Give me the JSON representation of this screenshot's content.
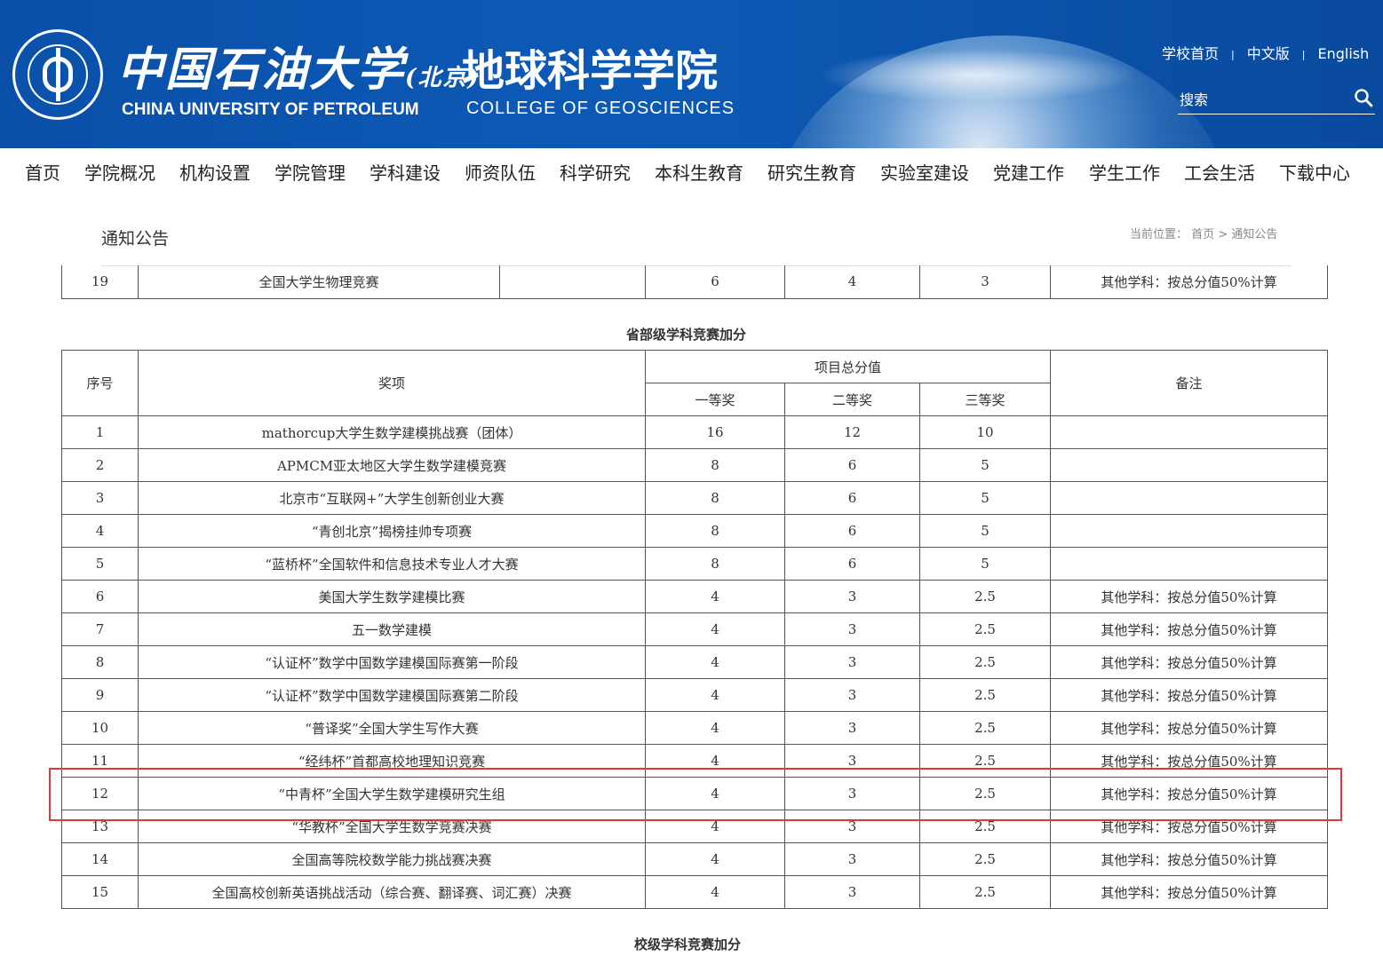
{
  "header": {
    "university_cn": "中国石油大学",
    "university_cn_suffix": "(北京)",
    "university_en": "CHINA UNIVERSITY OF PETROLEUM",
    "college_cn": "地球科学学院",
    "college_en": "COLLEGE OF GEOSCIENCES",
    "top_links": [
      "学校首页",
      "中文版",
      "English"
    ],
    "top_link_separator": "|",
    "search_placeholder": "搜索",
    "colors": {
      "header_bg": "#0c5ab6",
      "highlight": "#e5343a"
    }
  },
  "nav": {
    "items": [
      "首页",
      "学院概况",
      "机构设置",
      "学院管理",
      "学科建设",
      "师资队伍",
      "科学研究",
      "本科生教育",
      "研究生教育",
      "实验室建设",
      "党建工作",
      "学生工作",
      "工会生活",
      "下载中心"
    ]
  },
  "page": {
    "section_title": "通知公告",
    "breadcrumb_prefix": "当前位置：",
    "breadcrumb_home": "首页",
    "breadcrumb_sep": ">",
    "breadcrumb_current": "通知公告"
  },
  "prev_table": {
    "row": {
      "no": "19",
      "name": "全国大学生物理竞赛",
      "first": "6",
      "second": "4",
      "third": "3",
      "note": "其他学科：按总分值50%计算"
    }
  },
  "provincial_table": {
    "caption": "省部级学科竞赛加分",
    "headers": {
      "no": "序号",
      "name": "奖项",
      "total": "项目总分值",
      "first": "一等奖",
      "second": "二等奖",
      "third": "三等奖",
      "note": "备注"
    },
    "rows": [
      {
        "no": "1",
        "name": "mathorcup大学生数学建模挑战赛（团体）",
        "first": "16",
        "second": "12",
        "third": "10",
        "note": ""
      },
      {
        "no": "2",
        "name": "APMCM亚太地区大学生数学建模竞赛",
        "first": "8",
        "second": "6",
        "third": "5",
        "note": ""
      },
      {
        "no": "3",
        "name": "北京市“互联网+”大学生创新创业大赛",
        "first": "8",
        "second": "6",
        "third": "5",
        "note": ""
      },
      {
        "no": "4",
        "name": "“青创北京”揭榜挂帅专项赛",
        "first": "8",
        "second": "6",
        "third": "5",
        "note": ""
      },
      {
        "no": "5",
        "name": "“蓝桥杯”全国软件和信息技术专业人才大赛",
        "first": "8",
        "second": "6",
        "third": "5",
        "note": ""
      },
      {
        "no": "6",
        "name": "美国大学生数学建模比赛",
        "first": "4",
        "second": "3",
        "third": "2.5",
        "note": "其他学科：按总分值50%计算"
      },
      {
        "no": "7",
        "name": "五一数学建模",
        "first": "4",
        "second": "3",
        "third": "2.5",
        "note": "其他学科：按总分值50%计算"
      },
      {
        "no": "8",
        "name": "“认证杯”数学中国数学建模国际赛第一阶段",
        "first": "4",
        "second": "3",
        "third": "2.5",
        "note": "其他学科：按总分值50%计算"
      },
      {
        "no": "9",
        "name": "“认证杯”数学中国数学建模国际赛第二阶段",
        "first": "4",
        "second": "3",
        "third": "2.5",
        "note": "其他学科：按总分值50%计算"
      },
      {
        "no": "10",
        "name": "“普译奖”全国大学生写作大赛",
        "first": "4",
        "second": "3",
        "third": "2.5",
        "note": "其他学科：按总分值50%计算"
      },
      {
        "no": "11",
        "name": "“经纬杯”首都高校地理知识竞赛",
        "first": "4",
        "second": "3",
        "third": "2.5",
        "note": "其他学科：按总分值50%计算"
      },
      {
        "no": "12",
        "name": "“中青杯”全国大学生数学建模研究生组",
        "first": "4",
        "second": "3",
        "third": "2.5",
        "note": "其他学科：按总分值50%计算"
      },
      {
        "no": "13",
        "name": "“华教杯”全国大学生数学竞赛决赛",
        "first": "4",
        "second": "3",
        "third": "2.5",
        "note": "其他学科：按总分值50%计算"
      },
      {
        "no": "14",
        "name": "全国高等院校数学能力挑战赛决赛",
        "first": "4",
        "second": "3",
        "third": "2.5",
        "note": "其他学科：按总分值50%计算"
      },
      {
        "no": "15",
        "name": "全国高校创新英语挑战活动（综合赛、翻译赛、词汇赛）决赛",
        "first": "4",
        "second": "3",
        "third": "2.5",
        "note": "其他学科：按总分值50%计算"
      }
    ]
  },
  "school_table": {
    "caption": "校级学科竞赛加分"
  }
}
